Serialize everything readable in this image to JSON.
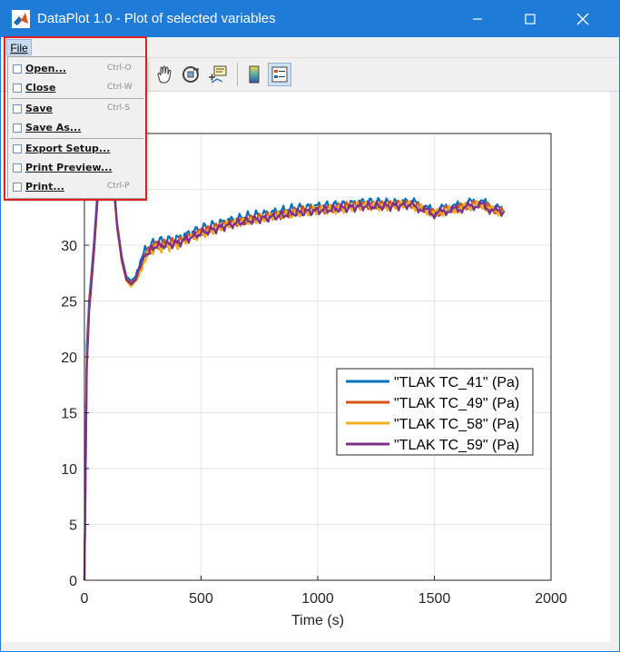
{
  "window": {
    "title": "DataPlot 1.0 - Plot of selected variables",
    "minimize_icon": "minimize-icon",
    "maximize_icon": "maximize-icon",
    "close_icon": "close-icon"
  },
  "menubar": {
    "file_label": "File"
  },
  "toolbar": {
    "icons": [
      "pan-hand-icon",
      "rotate-3d-icon",
      "data-cursor-icon",
      "colorbar-icon",
      "legend-icon"
    ]
  },
  "file_menu": {
    "items": [
      {
        "label": "Open...",
        "shortcut": "Ctrl-O"
      },
      {
        "label": "Close",
        "shortcut": "Ctrl-W"
      },
      {
        "label": "Save",
        "shortcut": "Ctrl-S"
      },
      {
        "label": "Save As...",
        "shortcut": ""
      },
      {
        "label": "Export Setup...",
        "shortcut": ""
      },
      {
        "label": "Print Preview...",
        "shortcut": ""
      },
      {
        "label": "Print...",
        "shortcut": "Ctrl-P"
      }
    ],
    "highlight_color": "#e02020"
  },
  "colors": {
    "titlebar": "#1e7bd7",
    "menu_highlight": "#c7d9ee"
  },
  "chart_data": {
    "type": "line",
    "xlabel": "Time (s)",
    "ylabel": "",
    "xlim": [
      0,
      2000
    ],
    "ylim": [
      0,
      40
    ],
    "x_ticks": [
      "0",
      "500",
      "1000",
      "1500",
      "2000"
    ],
    "y_ticks": [
      "0",
      "5",
      "10",
      "15",
      "20",
      "25",
      "30",
      "35"
    ],
    "grid": true,
    "legend_position": "right",
    "series": [
      {
        "name": "\"TLAK TC_41\" (Pa)",
        "color": "#0072bd",
        "x": [
          0,
          10,
          20,
          40,
          60,
          80,
          90,
          100,
          120,
          140,
          160,
          180,
          200,
          220,
          240,
          260,
          300,
          400,
          500,
          600,
          700,
          800,
          900,
          1000,
          1100,
          1200,
          1300,
          1400,
          1450,
          1500,
          1550,
          1600,
          1650,
          1700,
          1750,
          1800
        ],
        "y": [
          0,
          21,
          25,
          30,
          36,
          40,
          41,
          39,
          37,
          32,
          29,
          27.2,
          26.8,
          27.2,
          28.3,
          29.5,
          30.3,
          30.6,
          31.5,
          32.1,
          32.6,
          32.9,
          33.3,
          33.5,
          33.6,
          33.9,
          33.8,
          33.9,
          33.5,
          33.0,
          33.4,
          33.5,
          33.8,
          33.9,
          33.4,
          33.1
        ]
      },
      {
        "name": "\"TLAK TC_49\" (Pa)",
        "color": "#d95319",
        "x": [
          0,
          10,
          20,
          40,
          60,
          80,
          90,
          100,
          120,
          140,
          160,
          180,
          200,
          220,
          240,
          260,
          300,
          400,
          500,
          600,
          700,
          800,
          900,
          1000,
          1100,
          1200,
          1300,
          1400,
          1450,
          1500,
          1550,
          1600,
          1650,
          1700,
          1750,
          1800
        ],
        "y": [
          0,
          20,
          24.5,
          29.5,
          35.5,
          39.8,
          40.7,
          38.8,
          36.8,
          31.8,
          28.8,
          27.0,
          26.6,
          27.0,
          28.0,
          29.2,
          30.0,
          30.3,
          31.2,
          31.8,
          32.3,
          32.6,
          33.0,
          33.2,
          33.4,
          33.6,
          33.6,
          33.7,
          33.3,
          32.8,
          33.2,
          33.3,
          33.6,
          33.7,
          33.2,
          33.0
        ]
      },
      {
        "name": "\"TLAK TC_58\" (Pa)",
        "color": "#edb120",
        "x": [
          0,
          10,
          20,
          40,
          60,
          80,
          90,
          100,
          120,
          140,
          160,
          180,
          200,
          220,
          240,
          260,
          300,
          400,
          500,
          600,
          700,
          800,
          900,
          1000,
          1100,
          1200,
          1300,
          1400,
          1450,
          1500,
          1550,
          1600,
          1650,
          1700,
          1750,
          1800
        ],
        "y": [
          0,
          19.5,
          24,
          29,
          35,
          39.6,
          40.5,
          38.6,
          36.5,
          31.5,
          28.5,
          26.8,
          26.3,
          26.8,
          27.7,
          28.9,
          29.7,
          30.0,
          31.0,
          31.7,
          32.2,
          32.5,
          32.9,
          33.1,
          33.3,
          33.5,
          33.5,
          33.6,
          33.2,
          32.8,
          33.1,
          33.2,
          33.5,
          33.6,
          33.1,
          33.0
        ]
      },
      {
        "name": "\"TLAK TC_59\" (Pa)",
        "color": "#7e2f8e",
        "x": [
          0,
          10,
          20,
          40,
          60,
          80,
          90,
          100,
          120,
          140,
          160,
          180,
          200,
          220,
          240,
          260,
          300,
          400,
          500,
          600,
          700,
          800,
          900,
          1000,
          1100,
          1200,
          1300,
          1400,
          1450,
          1500,
          1550,
          1600,
          1650,
          1700,
          1750,
          1800
        ],
        "y": [
          0,
          19,
          24,
          29.2,
          35.3,
          39.7,
          40.6,
          38.7,
          36.7,
          31.7,
          28.7,
          26.9,
          26.5,
          26.9,
          27.9,
          29.1,
          29.9,
          30.2,
          31.1,
          31.7,
          32.2,
          32.5,
          32.9,
          33.1,
          33.3,
          33.5,
          33.5,
          33.6,
          33.2,
          32.8,
          33.1,
          33.2,
          33.5,
          33.6,
          33.1,
          33.0
        ]
      }
    ]
  }
}
